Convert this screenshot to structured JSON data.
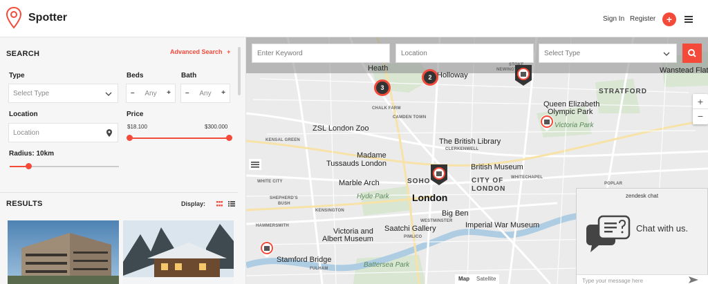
{
  "header": {
    "brand": "Spotter",
    "sign_in": "Sign In",
    "register": "Register",
    "add_icon": "+",
    "accent": "#f34a3a"
  },
  "sidebar": {
    "search_title": "SEARCH",
    "advanced_search": "Advanced Search",
    "advanced_plus": "+",
    "type_label": "Type",
    "type_placeholder": "Select Type",
    "beds_label": "Beds",
    "beds_value": "Any",
    "bath_label": "Bath",
    "bath_value": "Any",
    "minus": "–",
    "plus": "+",
    "location_label": "Location",
    "location_placeholder": "Location",
    "price_label": "Price",
    "price_min": "$18.100",
    "price_max": "$300.000",
    "radius_label": "Radius: 10km",
    "results_title": "RESULTS",
    "display_label": "Display:"
  },
  "map": {
    "keyword_placeholder": "Enter Keyword",
    "location_placeholder": "Location",
    "type_placeholder": "Select Type",
    "clusters": [
      "3",
      "2"
    ],
    "zoom_in": "+",
    "zoom_out": "−",
    "map_btn": "Map",
    "satellite_btn": "Satellite",
    "labels": {
      "heath": "Heath",
      "holloway": "Holloway",
      "stoke": "STOKE",
      "newington": "NEWINGTON",
      "wanstead": "Wanstead Flats",
      "stratford": "STRATFORD",
      "queen_elizabeth": "Queen Elizabeth",
      "olympic_park": "Olympic Park",
      "victoria_park": "Victoria Park",
      "chalk_farm": "CHALK FARM",
      "camden": "CAMDEN TOWN",
      "zsl": "ZSL London Zoo",
      "kensal": "KENSAL GREEN",
      "british_library": "The British Library",
      "clerkenwell": "CLERKENWELL",
      "madame": "Madame",
      "tussauds": "Tussauds London",
      "british_museum": "British Museum",
      "white_city": "WHITE CITY",
      "marble_arch": "Marble Arch",
      "soho": "SOHO",
      "city": "CITY OF",
      "city2": "LONDON",
      "whitechapel": "WHITECHAPEL",
      "poplar": "POPLAR",
      "shepherds": "SHEPHERD'S",
      "bush": "BUSH",
      "hyde_park": "Hyde Park",
      "london": "London",
      "kensington": "KENSINGTON",
      "big_ben": "Big Ben",
      "westminster": "WESTMINSTER",
      "hammersmith": "HAMMERSMITH",
      "victoria": "Victoria and",
      "albert": "Albert Museum",
      "saatchi": "Saatchi Gallery",
      "pimlico": "PIMLICO",
      "iwm": "Imperial War Museum",
      "stamford": "Stamford Bridge",
      "fulham": "FULHAM",
      "battersea": "Battersea Park"
    }
  },
  "chat": {
    "title": "zendesk chat",
    "message": "Chat with us.",
    "input_placeholder": "Type your message here"
  }
}
